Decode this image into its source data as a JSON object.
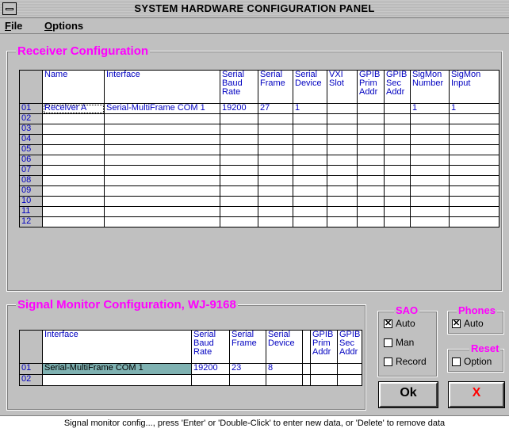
{
  "window": {
    "title": "SYSTEM HARDWARE CONFIGURATION PANEL"
  },
  "menu": {
    "file_first": "F",
    "file_rest": "ile",
    "options_first": "O",
    "options_rest": "ptions"
  },
  "receiver": {
    "title": "Receiver Configuration",
    "headers": [
      "Name",
      "Interface",
      "Serial Baud Rate",
      "Serial Frame",
      "Serial Device",
      "VXI Slot",
      "GPIB Prim Addr",
      "GPIB Sec Addr",
      "SigMon Number",
      "SigMon Input"
    ],
    "rows": [
      {
        "num": "01",
        "cells": [
          "Receiver A",
          "Serial-MultiFrame COM 1",
          "19200",
          "27",
          "1",
          "",
          "",
          "",
          "1",
          "1"
        ]
      },
      {
        "num": "02",
        "cells": [
          "",
          "",
          "",
          "",
          "",
          "",
          "",
          "",
          "",
          ""
        ]
      },
      {
        "num": "03",
        "cells": [
          "",
          "",
          "",
          "",
          "",
          "",
          "",
          "",
          "",
          ""
        ]
      },
      {
        "num": "04",
        "cells": [
          "",
          "",
          "",
          "",
          "",
          "",
          "",
          "",
          "",
          ""
        ]
      },
      {
        "num": "05",
        "cells": [
          "",
          "",
          "",
          "",
          "",
          "",
          "",
          "",
          "",
          ""
        ]
      },
      {
        "num": "06",
        "cells": [
          "",
          "",
          "",
          "",
          "",
          "",
          "",
          "",
          "",
          ""
        ]
      },
      {
        "num": "07",
        "cells": [
          "",
          "",
          "",
          "",
          "",
          "",
          "",
          "",
          "",
          ""
        ]
      },
      {
        "num": "08",
        "cells": [
          "",
          "",
          "",
          "",
          "",
          "",
          "",
          "",
          "",
          ""
        ]
      },
      {
        "num": "09",
        "cells": [
          "",
          "",
          "",
          "",
          "",
          "",
          "",
          "",
          "",
          ""
        ]
      },
      {
        "num": "10",
        "cells": [
          "",
          "",
          "",
          "",
          "",
          "",
          "",
          "",
          "",
          ""
        ]
      },
      {
        "num": "11",
        "cells": [
          "",
          "",
          "",
          "",
          "",
          "",
          "",
          "",
          "",
          ""
        ]
      },
      {
        "num": "12",
        "cells": [
          "",
          "",
          "",
          "",
          "",
          "",
          "",
          "",
          "",
          ""
        ]
      }
    ]
  },
  "sigmon": {
    "title": "Signal Monitor Configuration, WJ-9168",
    "headers": [
      "Interface",
      "Serial Baud Rate",
      "Serial Frame",
      "Serial Device",
      "",
      "GPIB Prim Addr",
      "GPIB Sec Addr"
    ],
    "rows": [
      {
        "num": "01",
        "cells": [
          "Serial-MultiFrame COM 1",
          "19200",
          "23",
          "8",
          "",
          "",
          ""
        ]
      },
      {
        "num": "02",
        "cells": [
          "",
          "",
          "",
          "",
          "",
          "",
          ""
        ]
      }
    ]
  },
  "sao": {
    "title": "SAO",
    "auto": "Auto",
    "man": "Man",
    "record": "Record"
  },
  "phones": {
    "title": "Phones",
    "auto": "Auto"
  },
  "reset": {
    "title": "Reset",
    "option": "Option"
  },
  "buttons": {
    "ok": "Ok",
    "cancel": "X"
  },
  "status": "Signal monitor config..., press 'Enter' or 'Double-Click' to enter new data, or 'Delete' to remove data",
  "colors": {
    "accent": "#ff00ff",
    "cell_text": "#0000c0",
    "cancel": "#ff0000"
  }
}
